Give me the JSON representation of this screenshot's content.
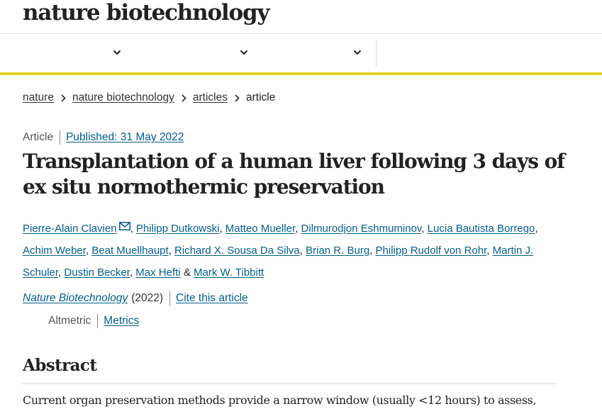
{
  "header": {
    "logo": "nature biotechnology",
    "nav_dropdowns": [
      "chevron-down",
      "chevron-down",
      "chevron-down"
    ]
  },
  "colors": {
    "link": "#025e8d",
    "accent_bar": "#e4d124",
    "text": "#222222"
  },
  "breadcrumb": {
    "items": [
      {
        "label": "nature"
      },
      {
        "label": "nature biotechnology"
      },
      {
        "label": "articles"
      },
      {
        "label": "article"
      }
    ]
  },
  "article": {
    "type": "Article",
    "published": "Published: 31 May 2022",
    "title": "Transplantation of a human liver following 3 days of ex situ normothermic preservation",
    "authors": [
      "Pierre-Alain Clavien",
      "Philipp Dutkowski",
      "Matteo Mueller",
      "Dilmurodjon Eshmuminov",
      "Lucia Bautista Borrego",
      "Achim Weber",
      "Beat Muellhaupt",
      "Richard X. Sousa Da Silva",
      "Brian R. Burg",
      "Philipp Rudolf von Rohr",
      "Martin J. Schuler",
      "Dustin Becker",
      "Max Hefti",
      "Mark W. Tibbitt"
    ],
    "separator": ",",
    "last_separator": "&",
    "journal": "Nature Biotechnology",
    "year": "(2022)",
    "cite_label": "Cite this article",
    "altmetric_label": "Altmetric",
    "metrics_label": "Metrics"
  },
  "abstract": {
    "heading": "Abstract",
    "first_line": "Current organ preservation methods provide a narrow window (usually <12 hours) to assess,"
  }
}
